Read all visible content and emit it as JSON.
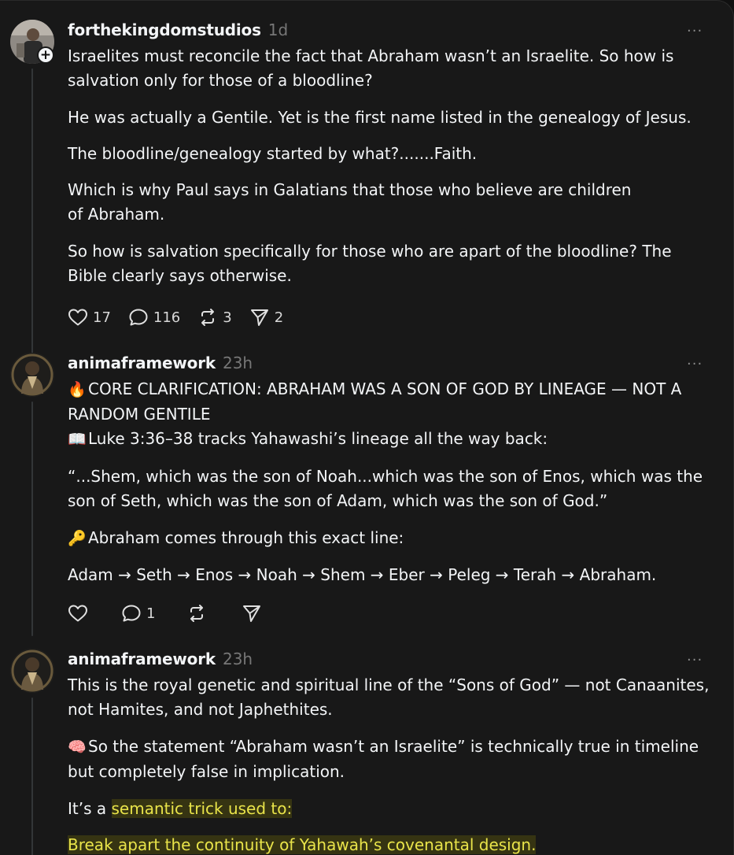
{
  "posts": [
    {
      "username": "forthekingdomstudios",
      "time": "1d",
      "more": "···",
      "paragraphs": [
        "Israelites must reconcile the fact that Abraham wasn’t an Israelite. So how is salvation only for those of a bloodline?",
        "He was actually a Gentile. Yet is the first name listed in the genealogy of Jesus.",
        "The bloodline/genealogy started by what?.......Faith.",
        "Which is why Paul says in Galatians that those who believe are children of Abraham.",
        "So how is salvation specifically for those who are apart of the bloodline? The Bible clearly says otherwise."
      ],
      "actions": {
        "likes": "17",
        "replies": "116",
        "reposts": "3",
        "shares": "2"
      }
    },
    {
      "username": "animaframework",
      "time": "23h",
      "more": "···",
      "fire_emoji": "🔥",
      "heading": "CORE CLARIFICATION: ABRAHAM WAS A SON OF GOD BY LINEAGE — NOT A RANDOM GENTILE",
      "book_emoji": "📖",
      "luke_line": "Luke 3:36–38 tracks Yahawashi’s lineage all the way back:",
      "quote": "“...Shem, which was the son of Noah...which was the son of Enos, which was the son of Seth, which was the son of Adam, which was the son of God.”",
      "key_emoji": "🔑",
      "key_line": "Abraham comes through this exact line:",
      "lineage": "Adam → Seth → Enos → Noah → Shem → Eber → Peleg → Terah → Abraham.",
      "actions": {
        "replies": "1"
      }
    },
    {
      "username": "animaframework",
      "time": "23h",
      "more": "···",
      "para1": "This is the royal genetic and spiritual line of the “Sons of God” — not Canaanites, not Hamites, and not Japhethites.",
      "brain_emoji": "🧠",
      "para2": "So the statement “Abraham wasn’t an Israelite” is technically true in timeline but completely false in implication.",
      "para3_prefix": "It’s a ",
      "para3_highlight": "semantic trick used to:",
      "para4_highlight": "Break apart the continuity of Yahawah’s covenantal design."
    }
  ]
}
